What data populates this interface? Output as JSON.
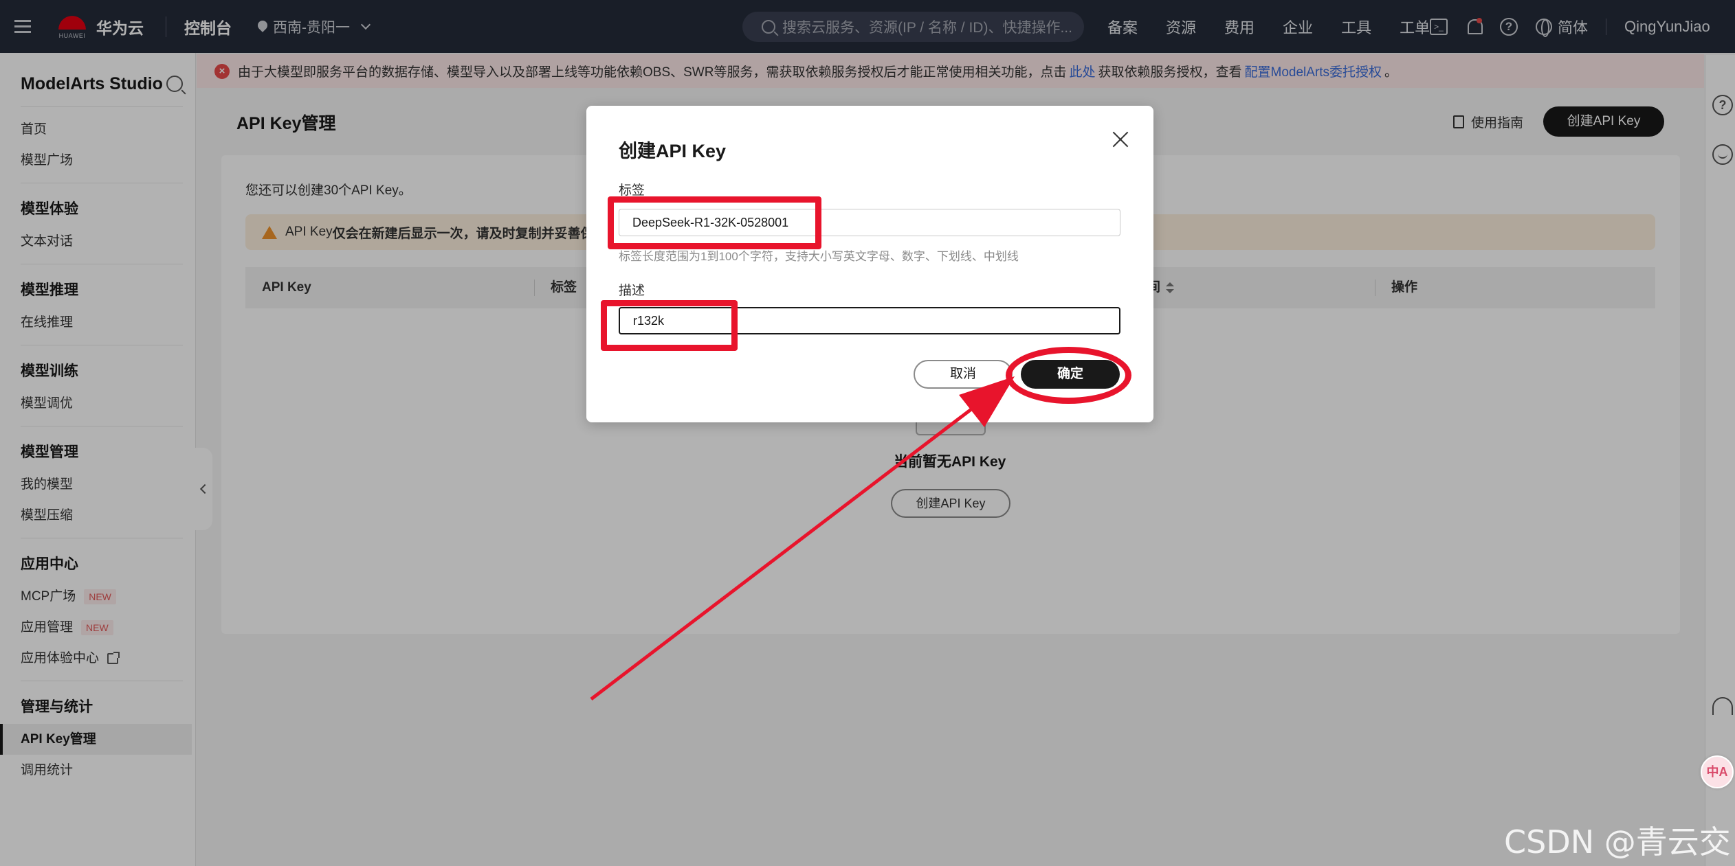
{
  "topnav": {
    "brand_logo_text": "HUAWEI",
    "brand_name": "华为云",
    "console": "控制台",
    "region": "西南-贵阳一",
    "search_placeholder": "搜索云服务、资源(IP / 名称 / ID)、快捷操作...",
    "links": [
      "备案",
      "资源",
      "费用",
      "企业",
      "工具",
      "工单"
    ],
    "terminal_icon_text": ">_",
    "help_icon_text": "?",
    "language": "简体",
    "username": "QingYunJiao"
  },
  "sidebar": {
    "title": "ModelArts Studio",
    "items_top": [
      "首页",
      "模型广场"
    ],
    "groups": [
      {
        "title": "模型体验",
        "items": [
          {
            "label": "文本对话"
          }
        ]
      },
      {
        "title": "模型推理",
        "items": [
          {
            "label": "在线推理"
          }
        ]
      },
      {
        "title": "模型训练",
        "items": [
          {
            "label": "模型调优"
          }
        ]
      },
      {
        "title": "模型管理",
        "items": [
          {
            "label": "我的模型"
          },
          {
            "label": "模型压缩"
          }
        ]
      },
      {
        "title": "应用中心",
        "items": [
          {
            "label": "MCP广场",
            "badge": "NEW"
          },
          {
            "label": "应用管理",
            "badge": "NEW"
          },
          {
            "label": "应用体验中心"
          }
        ]
      },
      {
        "title": "管理与统计",
        "items": [
          {
            "label": "API Key管理"
          },
          {
            "label": "调用统计"
          }
        ]
      }
    ]
  },
  "alert": {
    "icon_text": "×",
    "text": "由于大模型即服务平台的数据存储、模型导入以及部署上线等功能依赖OBS、SWR等服务，需获取依赖服务授权后才能正常使用相关功能，点击",
    "link1": "此处",
    "text2": "获取依赖服务授权，查看",
    "link2": "配置ModelArts委托授权",
    "text3": "。"
  },
  "page": {
    "title": "API Key管理",
    "guide_label": "使用指南",
    "create_button": "创建API Key",
    "quota": "您还可以创建30个API Key。",
    "warn_prefix": "API Key",
    "warn_bold": "仅会在新建后显示一次，请及时复制并妥善保存",
    "table_headers": [
      "API Key",
      "标签",
      "间",
      "操作"
    ],
    "empty_text": "当前暂无API Key",
    "empty_button": "创建API Key"
  },
  "modal": {
    "title": "创建API Key",
    "label_tag": "标签",
    "tag_value": "DeepSeek-R1-32K-0528001",
    "hint": "标签长度范围为1到100个字符，支持大小写英文字母、数字、下划线、中划线",
    "label_desc": "描述",
    "desc_value": "r132k",
    "cancel": "取消",
    "confirm": "确定"
  },
  "rail": {
    "help_icon_text": "?",
    "translate_icon_text": "中A"
  },
  "watermark": "CSDN @青云交",
  "colors": {
    "annotation": "#e8142c",
    "nav_bg": "#252b3a",
    "primary_button": "#191919"
  }
}
